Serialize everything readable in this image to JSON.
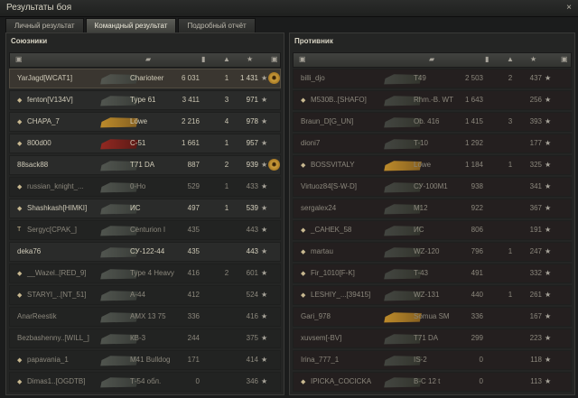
{
  "window": {
    "title": "Результаты боя",
    "close": "×"
  },
  "tabs": [
    {
      "label": "Личный результат",
      "active": false
    },
    {
      "label": "Командный результат",
      "active": true
    },
    {
      "label": "Подробный отчёт",
      "active": false
    }
  ],
  "columns": {
    "icons": [
      "squad-icon",
      "tank-icon",
      "damage-icon",
      "frags-icon",
      "experience-icon",
      "medal-icon"
    ]
  },
  "allies": {
    "title": "Союзники",
    "rows": [
      {
        "player": "YarJagd[WCAT1]",
        "tank": "Charioteer",
        "damage": "6 031",
        "frags": "1",
        "xp": "1 431",
        "self": true,
        "dead": false,
        "medal": true,
        "tank_color": "grey"
      },
      {
        "player": "fenton[V134V]",
        "tank": "Type 61",
        "damage": "3 411",
        "frags": "3",
        "xp": "971",
        "self": false,
        "dead": false,
        "marker": "◆",
        "tank_color": "grey"
      },
      {
        "player": "CHAPA_7",
        "tank": "Löwe",
        "damage": "2 216",
        "frags": "4",
        "xp": "978",
        "self": false,
        "dead": false,
        "marker": "◆",
        "tank_color": "gold"
      },
      {
        "player": "800d00",
        "tank": "C-51",
        "damage": "1 661",
        "frags": "1",
        "xp": "957",
        "self": false,
        "dead": false,
        "marker": "◆",
        "tank_color": "red"
      },
      {
        "player": "88sack88",
        "tank": "T71 DA",
        "damage": "887",
        "frags": "2",
        "xp": "939",
        "self": false,
        "dead": false,
        "medal": true,
        "tank_color": "grey"
      },
      {
        "player": "russian_knight_...",
        "tank": "0-Ho",
        "damage": "529",
        "frags": "1",
        "xp": "433",
        "self": false,
        "dead": true,
        "marker": "◆",
        "tank_color": "grey"
      },
      {
        "player": "Shashkash[HIMKI]",
        "tank": "ИС",
        "damage": "497",
        "frags": "1",
        "xp": "539",
        "self": false,
        "dead": false,
        "marker": "◆",
        "tank_color": "grey"
      },
      {
        "player": "Sergyc[CPAK_]",
        "tank": "Centurion I",
        "damage": "435",
        "frags": "",
        "xp": "443",
        "self": false,
        "dead": true,
        "marker": "T",
        "tank_color": "grey"
      },
      {
        "player": "deka76",
        "tank": "СУ-122-44",
        "damage": "435",
        "frags": "",
        "xp": "443",
        "self": false,
        "dead": false,
        "tank_color": "grey"
      },
      {
        "player": "__Wazel..[RED_9]",
        "tank": "Type 4 Heavy",
        "damage": "416",
        "frags": "2",
        "xp": "601",
        "self": false,
        "dead": true,
        "marker": "◆",
        "tank_color": "grey"
      },
      {
        "player": "STARYI_..[NT_51]",
        "tank": "A-44",
        "damage": "412",
        "frags": "",
        "xp": "524",
        "self": false,
        "dead": true,
        "marker": "◆",
        "tank_color": "grey"
      },
      {
        "player": "AnarReestik",
        "tank": "AMX 13 75",
        "damage": "336",
        "frags": "",
        "xp": "416",
        "self": false,
        "dead": true,
        "tank_color": "grey"
      },
      {
        "player": "Bezbashenny..[WILL_]",
        "tank": "КВ-3",
        "damage": "244",
        "frags": "",
        "xp": "375",
        "self": false,
        "dead": true,
        "tank_color": "grey"
      },
      {
        "player": "papavania_1",
        "tank": "M41 Bulldog",
        "damage": "171",
        "frags": "",
        "xp": "414",
        "self": false,
        "dead": true,
        "marker": "◆",
        "tank_color": "grey"
      },
      {
        "player": "Dimas1..[OGDTB]",
        "tank": "Т-54 обл.",
        "damage": "0",
        "frags": "",
        "xp": "346",
        "self": false,
        "dead": true,
        "marker": "◆",
        "tank_color": "grey"
      }
    ]
  },
  "enemies": {
    "title": "Противник",
    "rows": [
      {
        "player": "billi_djo",
        "tank": "T49",
        "damage": "2 503",
        "frags": "2",
        "xp": "437",
        "dead": true,
        "tank_color": "grey"
      },
      {
        "player": "M530B..[SHAFO]",
        "tank": "Rhm.-B. WT",
        "damage": "1 643",
        "frags": "",
        "xp": "256",
        "dead": true,
        "marker": "◆",
        "tank_color": "grey"
      },
      {
        "player": "Braun_D[G_UN]",
        "tank": "Ob. 416",
        "damage": "1 415",
        "frags": "3",
        "xp": "393",
        "dead": true,
        "tank_color": "grey"
      },
      {
        "player": "dioni7",
        "tank": "T-10",
        "damage": "1 292",
        "frags": "",
        "xp": "177",
        "dead": true,
        "tank_color": "grey"
      },
      {
        "player": "BOSSVITALY",
        "tank": "Löwe",
        "damage": "1 184",
        "frags": "1",
        "xp": "325",
        "dead": true,
        "marker": "◆",
        "tank_color": "gold"
      },
      {
        "player": "Virtuoz84[S-W-D]",
        "tank": "СУ-100М1",
        "damage": "938",
        "frags": "",
        "xp": "341",
        "dead": true,
        "tank_color": "grey"
      },
      {
        "player": "sergalex24",
        "tank": "M12",
        "damage": "922",
        "frags": "",
        "xp": "367",
        "dead": true,
        "tank_color": "grey"
      },
      {
        "player": "_CAHEK_58",
        "tank": "ИС",
        "damage": "806",
        "frags": "",
        "xp": "191",
        "dead": true,
        "marker": "◆",
        "tank_color": "grey"
      },
      {
        "player": "martau",
        "tank": "WZ-120",
        "damage": "796",
        "frags": "1",
        "xp": "247",
        "dead": true,
        "marker": "◆",
        "tank_color": "grey"
      },
      {
        "player": "Fir_1010[F-K]",
        "tank": "T-43",
        "damage": "491",
        "frags": "",
        "xp": "332",
        "dead": true,
        "marker": "◆",
        "tank_color": "grey"
      },
      {
        "player": "LESHIY_...[39415]",
        "tank": "WZ-131",
        "damage": "440",
        "frags": "1",
        "xp": "261",
        "dead": true,
        "marker": "◆",
        "tank_color": "grey"
      },
      {
        "player": "Gari_978",
        "tank": "Somua SM",
        "damage": "336",
        "frags": "",
        "xp": "167",
        "dead": true,
        "tank_color": "gold"
      },
      {
        "player": "xuvsem[-BV]",
        "tank": "T71 DA",
        "damage": "299",
        "frags": "",
        "xp": "223",
        "dead": true,
        "tank_color": "grey"
      },
      {
        "player": "Irina_777_1",
        "tank": "IS-2",
        "damage": "0",
        "frags": "",
        "xp": "118",
        "dead": true,
        "tank_color": "grey"
      },
      {
        "player": "IPICKA_COCICKA",
        "tank": "B-C 12 t",
        "damage": "0",
        "frags": "",
        "xp": "113",
        "dead": true,
        "marker": "◆",
        "tank_color": "grey"
      }
    ]
  }
}
